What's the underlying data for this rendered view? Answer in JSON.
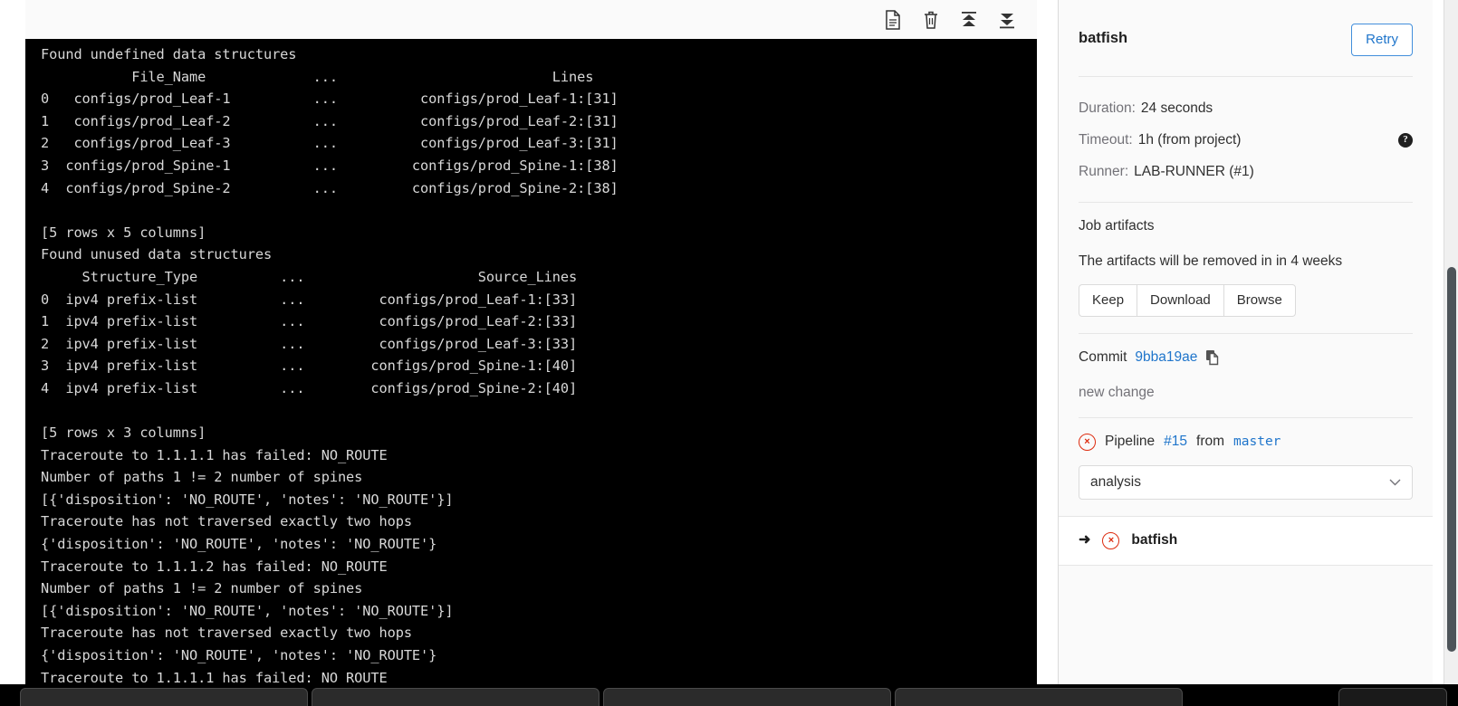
{
  "log": {
    "toolbar": {
      "icons": [
        {
          "name": "raw-log-icon",
          "title": "Show complete raw"
        },
        {
          "name": "trash-icon",
          "title": "Erase job log"
        },
        {
          "name": "scroll-to-top-icon",
          "title": "Scroll to top"
        },
        {
          "name": "scroll-to-bottom-icon",
          "title": "Scroll to bottom"
        }
      ]
    },
    "lines": [
      "",
      "Found undefined data structures",
      "           File_Name             ...                          Lines",
      "0   configs/prod_Leaf-1          ...          configs/prod_Leaf-1:[31]",
      "1   configs/prod_Leaf-2          ...          configs/prod_Leaf-2:[31]",
      "2   configs/prod_Leaf-3          ...          configs/prod_Leaf-3:[31]",
      "3  configs/prod_Spine-1          ...         configs/prod_Spine-1:[38]",
      "4  configs/prod_Spine-2          ...         configs/prod_Spine-2:[38]",
      "",
      "[5 rows x 5 columns]",
      "Found unused data structures",
      "     Structure_Type          ...                     Source_Lines",
      "0  ipv4 prefix-list          ...         configs/prod_Leaf-1:[33]",
      "1  ipv4 prefix-list          ...         configs/prod_Leaf-2:[33]",
      "2  ipv4 prefix-list          ...         configs/prod_Leaf-3:[33]",
      "3  ipv4 prefix-list          ...        configs/prod_Spine-1:[40]",
      "4  ipv4 prefix-list          ...        configs/prod_Spine-2:[40]",
      "",
      "[5 rows x 3 columns]",
      "Traceroute to 1.1.1.1 has failed: NO_ROUTE",
      "Number of paths 1 != 2 number of spines",
      "[{'disposition': 'NO_ROUTE', 'notes': 'NO_ROUTE'}]",
      "Traceroute has not traversed exactly two hops",
      "{'disposition': 'NO_ROUTE', 'notes': 'NO_ROUTE'}",
      "Traceroute to 1.1.1.2 has failed: NO_ROUTE",
      "Number of paths 1 != 2 number of spines",
      "[{'disposition': 'NO_ROUTE', 'notes': 'NO_ROUTE'}]",
      "Traceroute has not traversed exactly two hops",
      "{'disposition': 'NO_ROUTE', 'notes': 'NO_ROUTE'}",
      "Traceroute to 1.1.1.1 has failed: NO_ROUTE"
    ]
  },
  "sidebar": {
    "job_name": "batfish",
    "retry_label": "Retry",
    "meta": {
      "duration_label": "Duration:",
      "duration_value": "24 seconds",
      "timeout_label": "Timeout:",
      "timeout_value": "1h (from project)",
      "timeout_help_glyph": "?",
      "runner_label": "Runner:",
      "runner_value": "LAB-RUNNER (#1)"
    },
    "artifacts": {
      "title": "Job artifacts",
      "expiry_text": "The artifacts will be removed in in 4 weeks",
      "keep_label": "Keep",
      "download_label": "Download",
      "browse_label": "Browse"
    },
    "commit": {
      "label": "Commit",
      "sha": "9bba19ae",
      "message": "new change"
    },
    "pipeline": {
      "status_glyph": "×",
      "label": "Pipeline",
      "number": "#15",
      "from_label": "from",
      "ref": "master",
      "stage_selected": "analysis",
      "chevron": "⌄"
    },
    "jobs": [
      {
        "name": "batfish",
        "status_glyph": "×",
        "arrow": "➜"
      }
    ]
  },
  "colors": {
    "link": "#1f75cb",
    "danger": "#dd2b0e",
    "terminal_bg": "#000000",
    "terminal_fg": "#d8d8d8",
    "panel_bg": "#fafafa"
  }
}
